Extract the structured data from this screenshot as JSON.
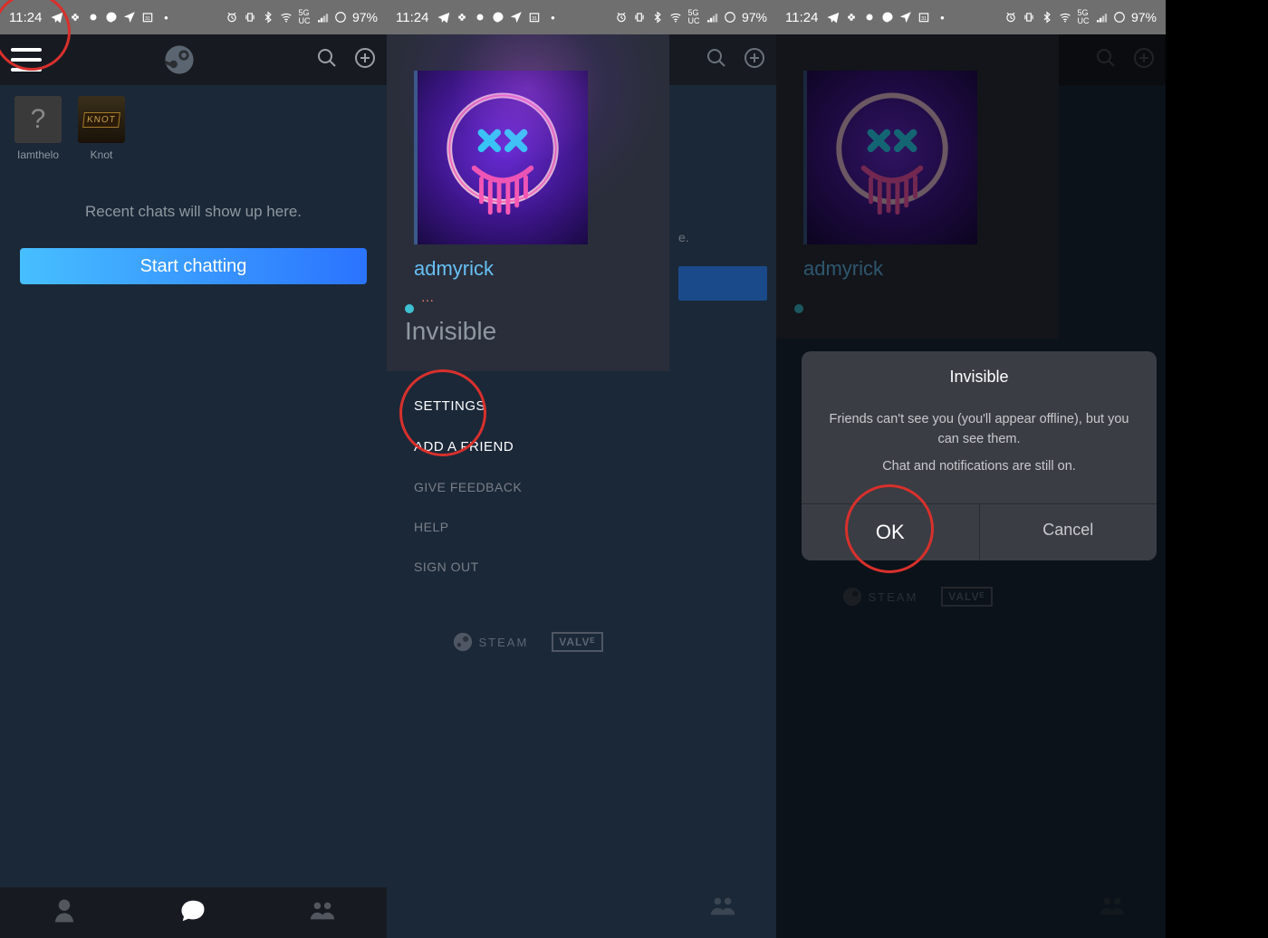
{
  "statusbar": {
    "time": "11:24",
    "battery": "97%"
  },
  "panel1": {
    "friends": [
      {
        "name": "Iamthelo"
      },
      {
        "name": "Knot"
      }
    ],
    "hint": "Recent chats will show up here.",
    "cta": "Start chatting"
  },
  "drawer": {
    "username": "admyrick",
    "status_label": "Invisible",
    "menu": {
      "settings": "SETTINGS",
      "add_friend": "ADD A FRIEND",
      "give_feedback": "GIVE FEEDBACK",
      "help": "HELP",
      "sign_out": "SIGN OUT"
    },
    "brand_steam": "STEAM",
    "brand_valve": "VALVᴱ"
  },
  "sliver": {
    "hint_tail": "e."
  },
  "dialog": {
    "title": "Invisible",
    "line1": "Friends can't see you (you'll appear offline), but you can see them.",
    "line2": "Chat and notifications are still on.",
    "ok": "OK",
    "cancel": "Cancel"
  }
}
